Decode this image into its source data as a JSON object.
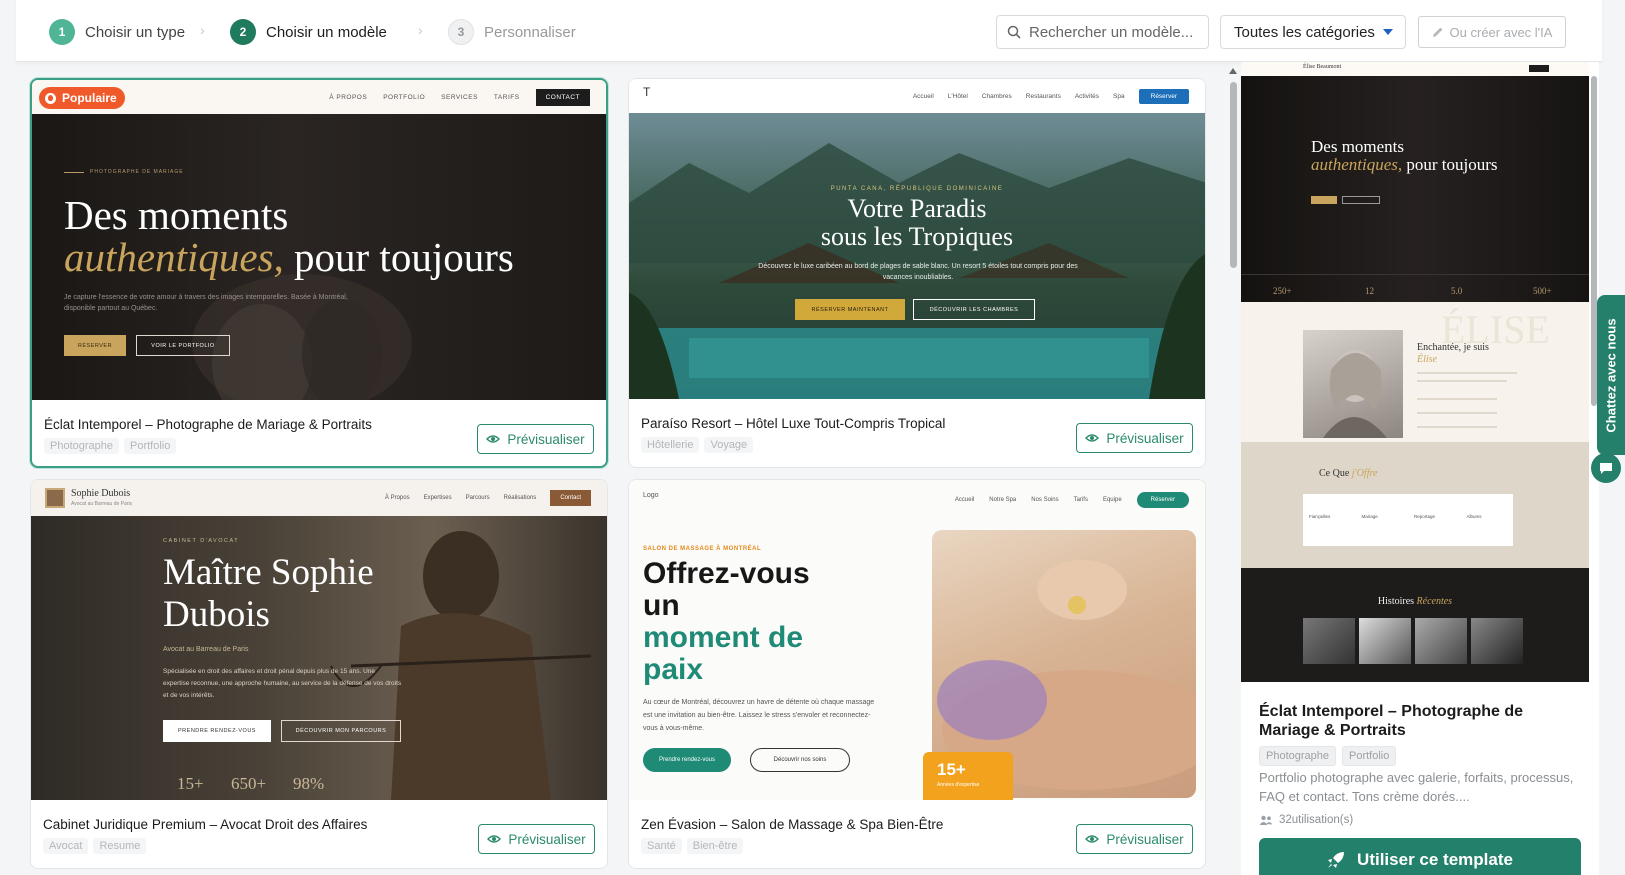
{
  "steps": [
    {
      "num": "1",
      "label": "Choisir un type"
    },
    {
      "num": "2",
      "label": "Choisir un modèle"
    },
    {
      "num": "3",
      "label": "Personnaliser"
    }
  ],
  "toolbar": {
    "search_placeholder": "Rechercher un modèle...",
    "category_value": "Toutes les catégories",
    "ai_button": "Ou créer avec l'IA"
  },
  "cards": [
    {
      "title": "Éclat Intemporel – Photographe de Mariage & Portraits",
      "tags": [
        "Photographe",
        "Portfolio"
      ],
      "badge": "Populaire",
      "preview_label": "Prévisualiser",
      "thumb": {
        "nav": [
          "À PROPOS",
          "PORTFOLIO",
          "SERVICES",
          "TARIFS"
        ],
        "nav_cta": "CONTACT",
        "eyebrow": "PHOTOGRAPHE DE MARIAGE",
        "headline_1": "Des moments",
        "headline_em": "authentiques,",
        "headline_2": "pour toujours",
        "body": "Je capture l'essence de votre amour à travers des images intemporelles. Basée à Montréal, disponible partout au Québec.",
        "btn_primary": "RÉSERVER",
        "btn_secondary": "VOIR LE PORTFOLIO"
      }
    },
    {
      "title": "Paraíso Resort – Hôtel Luxe Tout-Compris Tropical",
      "tags": [
        "Hôtellerie",
        "Voyage"
      ],
      "preview_label": "Prévisualiser",
      "thumb": {
        "logo": "T",
        "nav": [
          "Accueil",
          "L'Hôtel",
          "Chambres",
          "Restaurants",
          "Activités",
          "Spa"
        ],
        "nav_cta": "Réserver",
        "eyebrow": "PUNTA CANA, RÉPUBLIQUE DOMINICAINE",
        "headline_1": "Votre Paradis",
        "headline_2": "sous les Tropiques",
        "body": "Découvrez le luxe caribéen au bord de plages de sable blanc. Un resort 5 étoiles tout compris pour des vacances inoubliables.",
        "btn_primary": "RÉSERVER MAINTENANT",
        "btn_secondary": "DÉCOUVRIR LES CHAMBRES"
      }
    },
    {
      "title": "Cabinet Juridique Premium – Avocat Droit des Affaires",
      "tags": [
        "Avocat",
        "Resume"
      ],
      "preview_label": "Prévisualiser",
      "thumb": {
        "brand": "Sophie Dubois",
        "brand_sub": "Avocat au Barreau de Paris",
        "nav": [
          "À Propos",
          "Expertises",
          "Parcours",
          "Réalisations"
        ],
        "nav_cta": "Contact",
        "eyebrow": "CABINET D'AVOCAT",
        "headline_1": "Maître Sophie",
        "headline_2": "Dubois",
        "sub": "Avocat au Barreau de Paris",
        "body": "Spécialisée en droit des affaires et droit pénal depuis plus de 15 ans. Une expertise reconnue, une approche humaine, au service de la défense de vos droits et de vos intérêts.",
        "btn_primary": "PRENDRE RENDEZ-VOUS",
        "btn_secondary": "DÉCOUVRIR MON PARCOURS",
        "stats": [
          "15+",
          "650+",
          "98%"
        ]
      }
    },
    {
      "title": "Zen Évasion – Salon de Massage & Spa Bien-Être",
      "tags": [
        "Santé",
        "Bien-être"
      ],
      "preview_label": "Prévisualiser",
      "thumb": {
        "logo": "Logo",
        "nav": [
          "Accueil",
          "Notre Spa",
          "Nos Soins",
          "Tarifs",
          "Equipe"
        ],
        "nav_cta": "Réserver",
        "eyebrow": "SALON DE MASSAGE À MONTRÉAL",
        "headline_1": "Offrez-vous",
        "headline_2": "un",
        "headline_3": "moment de",
        "headline_4": "paix",
        "body": "Au cœur de Montréal, découvrez un havre de détente où chaque massage est une invitation au bien-être. Laissez le stress s'envoler et reconnectez-vous à vous-même.",
        "btn_primary": "Prendre rendez-vous",
        "btn_secondary": "Découvrir nos soins",
        "stat_value": "15+",
        "stat_label": "Années d'expertise"
      }
    }
  ],
  "panel": {
    "title": "Éclat Intemporel – Photographe de Mariage & Portraits",
    "tags": [
      "Photographe",
      "Portfolio"
    ],
    "description": "Portfolio photographe avec galerie, forfaits, processus, FAQ et contact. Tons crème dorés....",
    "uses": "32utilisation(s)",
    "use_button": "Utiliser ce template",
    "preview": {
      "brand": "Élise Beaumont",
      "headline_1": "Des moments",
      "headline_em": "authentiques,",
      "headline_2": "pour toujours",
      "stats": [
        "250+",
        "12",
        "5.0",
        "500+"
      ],
      "about_title": "Enchantée, je suis",
      "about_name": "Élise",
      "watermark": "ÉLISE",
      "offer_title": "Ce Que",
      "offer_em": "j'Offre",
      "offer_items": [
        "Fiançailles",
        "Mariage",
        "Reportage",
        "Albums"
      ],
      "stories_title": "Histoires",
      "stories_em": "Récentes"
    }
  },
  "chat": {
    "label": "Chattez avec nous"
  },
  "colors": {
    "primary": "#23806a",
    "accent": "#f05a2a",
    "gold": "#c9a45c"
  }
}
